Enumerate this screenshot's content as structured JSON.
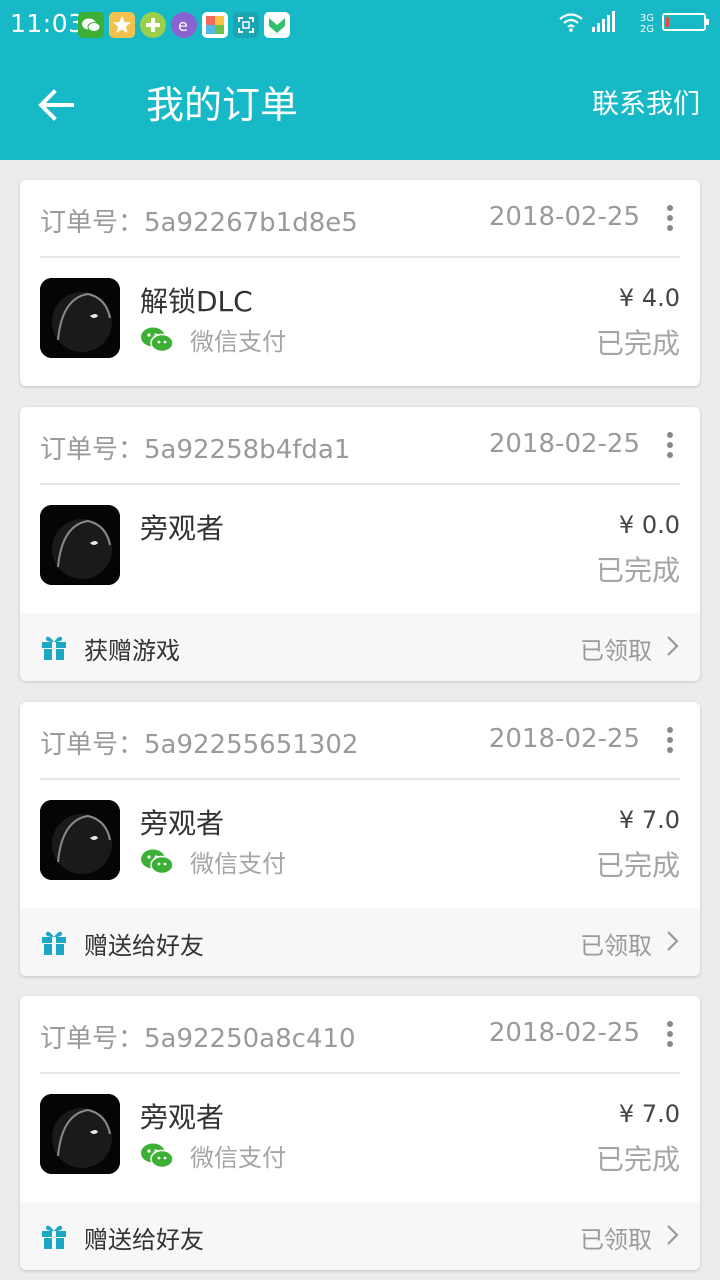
{
  "status_bar": {
    "time": "11:03",
    "net_top": "3G",
    "net_bottom": "2G",
    "icons": [
      "wechat-icon",
      "game-center-icon",
      "plus-app-icon",
      "browser-icon",
      "photos-app-icon",
      "scan-app-icon",
      "shield-app-icon"
    ],
    "right_icons": [
      "wifi-icon",
      "signal-icon",
      "signal-icon",
      "battery-icon"
    ]
  },
  "header": {
    "title": "我的订单",
    "contact_label": "联系我们",
    "back_icon": "arrow-left-icon"
  },
  "colors": {
    "accent": "#17b9c7",
    "wechat_green": "#3cb034",
    "gift": "#1aa8c4"
  },
  "orders": [
    {
      "order_label": "订单号：5a92267b1d8e5",
      "date": "2018-02-25",
      "item": "解锁DLC",
      "payment": "微信支付",
      "price": "¥ 4.0",
      "status": "已完成"
    },
    {
      "order_label": "订单号：5a92258b4fda1",
      "date": "2018-02-25",
      "item": "旁观者",
      "price": "¥ 0.0",
      "status": "已完成",
      "gift_label": "获赠游戏",
      "gift_status": "已领取"
    },
    {
      "order_label": "订单号：5a92255651302",
      "date": "2018-02-25",
      "item": "旁观者",
      "payment": "微信支付",
      "price": "¥ 7.0",
      "status": "已完成",
      "gift_label": "赠送给好友",
      "gift_status": "已领取"
    },
    {
      "order_label": "订单号：5a92250a8c410",
      "date": "2018-02-25",
      "item": "旁观者",
      "payment": "微信支付",
      "price": "¥ 7.0",
      "status": "已完成",
      "gift_label": "赠送给好友",
      "gift_status": "已领取"
    }
  ]
}
